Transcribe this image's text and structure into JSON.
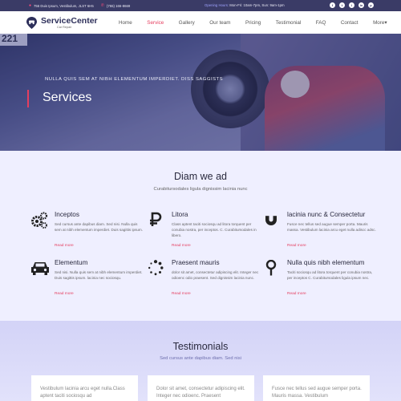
{
  "topbar": {
    "address": "756 Duis Ipsum, Vestibulum, JLST 6H5",
    "phone": "(755) 166-8669",
    "hours_label": "Opening Hours:",
    "hours_value": " Mon-Fri: 10am-7pm, Sun: 9am-1pm",
    "social": [
      "f",
      "t",
      "i",
      "in",
      "p"
    ]
  },
  "brand": {
    "name": "ServiceCenter",
    "sub": "Car Repair"
  },
  "menu": [
    "Home",
    "Service",
    "Gallery",
    "Our team",
    "Pricing",
    "Testimonial",
    "FAQ",
    "Contact",
    "More▾"
  ],
  "hero": {
    "plate": "221",
    "tagline": "NULLA QUIS SEM AT NIBH ELEMENTUM IMPERDIET. DISS SAGGISTS",
    "title": "Services"
  },
  "features_section": {
    "title": "Diam we ad",
    "lead": "Curabitursodales ligula dignissim lacinia nunc",
    "items": [
      {
        "icon": "gears-icon",
        "title": "Inceptos",
        "text": "Sed cursus ante dapibus diam. Sed nisi. Nulla quis sem at nibh elementum imperdiet. Duis sagittis ipsum.",
        "link": "Read more"
      },
      {
        "icon": "ruble-icon",
        "title": "Litora",
        "text": "Class aptent taciti sociosqu ad litora torquent per conubia nostra, per inceptos. C. Curabitursodales in libero.",
        "link": "Read more"
      },
      {
        "icon": "magnet-icon",
        "title": "lacinia nunc & Consectetur",
        "text": "Fusce nec tellus sed augue semper porta. Mauris massa. Vestibulum lacinia arcu eget nulla adiscc adsc.",
        "link": "Read more"
      },
      {
        "icon": "car-icon",
        "title": "Elementum",
        "text": "Sed nisi. Nulla quis sem at nibh elementum imperdiet. Duis sagittis ipsum. lacinia nec sociosqu.",
        "link": "Read more"
      },
      {
        "icon": "spinner-icon",
        "title": "Praesent mauris",
        "text": "dolor sit amet, consectetur adipiscing elit. Integer nec odioenc odio praesent. Sed dignissim lacinia nunc.",
        "link": "Read more"
      },
      {
        "icon": "map-pin-icon",
        "title": "Nulla quis nibh elementum",
        "text": "Taciti sociosqu ad litora torquent per conubia nostra, per inceptos C. Curabitursodales ligula ipsum nec.",
        "link": "Read more"
      }
    ]
  },
  "testimonials": {
    "title": "Testimonials",
    "lead": "Sed cursus ante dapibus diam. Sed nisi",
    "cards": [
      "Vestibulum lacinia arcu eget nulla.Class aptent taciti sociosqu ad",
      "Dolor sit amet, consectetur adipiscing elit. Integer nec odioenc. Praesent",
      "Fusce nec tellus sed augue semper porta. Mauris massa. Vestibulum"
    ]
  },
  "colors": {
    "accent": "#e53e5f",
    "navy": "#3a3b66",
    "brand": "#2d2f5a",
    "light_bg": "#efefff"
  }
}
